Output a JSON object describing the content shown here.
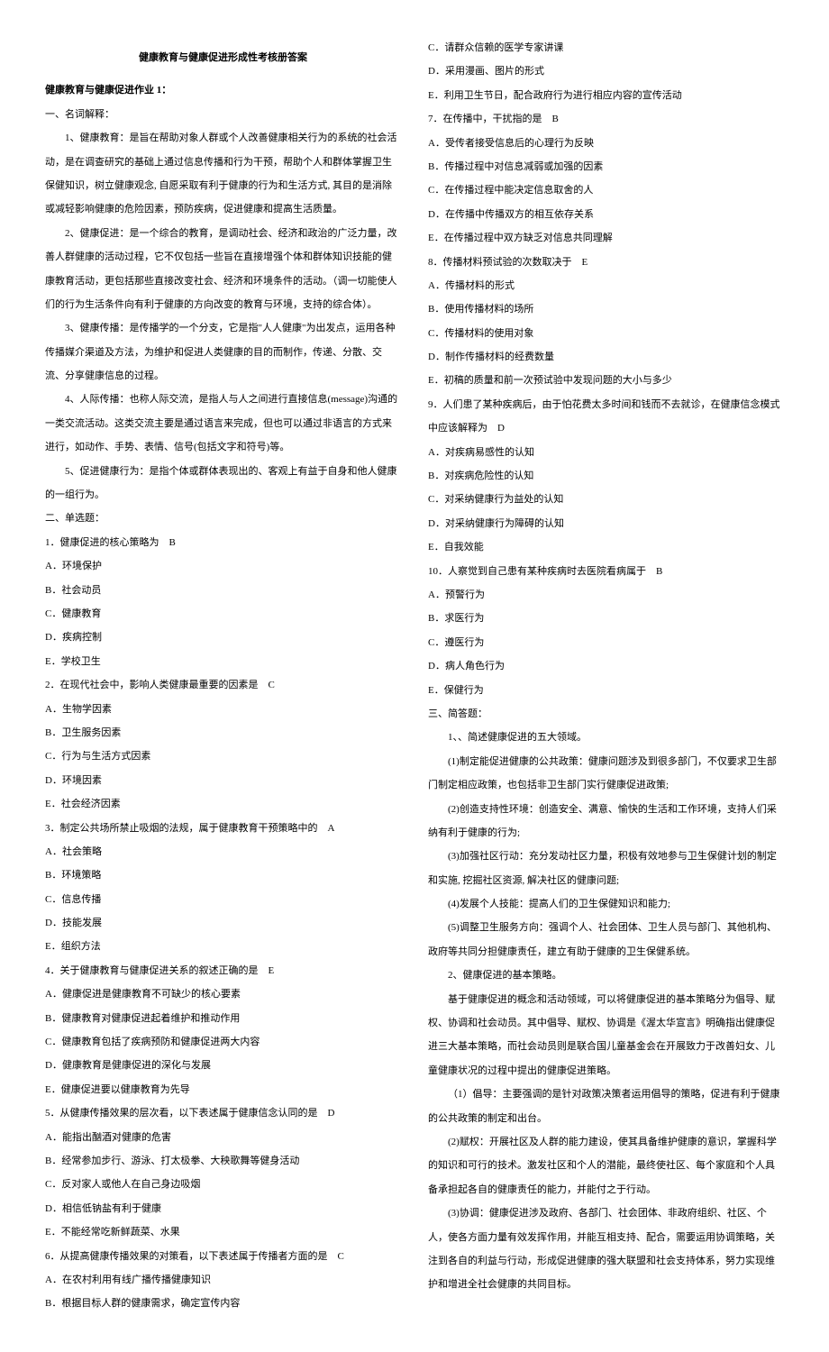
{
  "title": "健康教育与健康促进形成性考核册答案",
  "assignment": "健康教育与健康促进作业 1：",
  "sec1": "一、名词解释：",
  "def1": "1、健康教育：是旨在帮助对象人群或个人改善健康相关行为的系统的社会活动，是在调查研究的基础上通过信息传播和行为干预，帮助个人和群体掌握卫生保健知识，树立健康观念, 自愿采取有利于健康的行为和生活方式, 其目的是消除或减轻影响健康的危险因素，预防疾病，促进健康和提高生活质量。",
  "def2": "2、健康促进：是一个综合的教育，是调动社会、经济和政治的广泛力量，改善人群健康的活动过程，它不仅包括一些旨在直接增强个体和群体知识技能的健康教育活动，更包括那些直接改变社会、经济和环境条件的活动。（调一切能使人们的行为生活条件向有利于健康的方向改变的教育与环境，支持的综合体）。",
  "def3": "3、健康传播：是传播学的一个分支，它是指\"人人健康\"为出发点，运用各种传播媒介渠道及方法，为维护和促进人类健康的目的而制作，传递、分散、交流、分享健康信息的过程。",
  "def4": "4、人际传播：也称人际交流，是指人与人之间进行直接信息(message)沟通的一类交流活动。这类交流主要是通过语言来完成，但也可以通过非语言的方式来进行，如动作、手势、表情、信号(包括文字和符号)等。",
  "def5": "5、促进健康行为：是指个体或群体表现出的、客观上有益于自身和他人健康的一组行为。",
  "sec2": "二、单选题：",
  "q1": {
    "stem": "1．健康促进的核心策略为",
    "ans": "B",
    "a": "A．环境保护",
    "b": "B．社会动员",
    "c": "C．健康教育",
    "d": "D．疾病控制",
    "e": "E．学校卫生"
  },
  "q2": {
    "stem": "2．在现代社会中，影响人类健康最重要的因素是",
    "ans": "C",
    "a": "A．生物学因素",
    "b": "B．卫生服务因素",
    "c": "C．行为与生活方式因素",
    "d": "D．环境因素",
    "e": "E．社会经济因素"
  },
  "q3": {
    "stem": "3．制定公共场所禁止吸烟的法规，属于健康教育干预策略中的",
    "ans": "A",
    "a": "A．社会策略",
    "b": "B．环境策略",
    "c": "C．信息传播",
    "d": "D．技能发展",
    "e": "E．组织方法"
  },
  "q4": {
    "stem": "4．关于健康教育与健康促进关系的叙述正确的是",
    "ans": "E",
    "a": "A．健康促进是健康教育不可缺少的核心要素",
    "b": "B．健康教育对健康促进起着维护和推动作用",
    "c": "C．健康教育包括了疾病预防和健康促进两大内容",
    "d": "D．健康教育是健康促进的深化与发展",
    "e": "E．健康促进要以健康教育为先导"
  },
  "q5": {
    "stem": "5．从健康传播效果的层次看，以下表述属于健康信念认同的是",
    "ans": "D",
    "a": "A．能指出酗酒对健康的危害",
    "b": "B．经常参加步行、游泳、打太极拳、大秧歌舞等健身活动",
    "c": "C．反对家人或他人在自己身边吸烟",
    "d": "D．相信低钠盐有利于健康",
    "e": "E．不能经常吃新鲜蔬菜、水果"
  },
  "q6": {
    "stem": "6．从提高健康传播效果的对策看，以下表述属于传播者方面的是",
    "ans": "C",
    "a": "A．在农村利用有线广播传播健康知识",
    "b": "B．根据目标人群的健康需求，确定宣传内容",
    "c": "C．请群众信赖的医学专家讲课",
    "d": "D．采用漫画、图片的形式",
    "e": "E．利用卫生节日，配合政府行为进行相应内容的宣传活动"
  },
  "q7": {
    "stem": "7．在传播中，干扰指的是",
    "ans": "B",
    "a": "A．受传者接受信息后的心理行为反映",
    "b": "B．传播过程中对信息减弱或加强的因素",
    "c": "C．在传播过程中能决定信息取舍的人",
    "d": "D．在传播中传播双方的相互依存关系",
    "e": "E．在传播过程中双方缺乏对信息共同理解"
  },
  "q8": {
    "stem": "8．传播材料预试验的次数取决于",
    "ans": "E",
    "a": "A．传播材料的形式",
    "b": "B．使用传播材料的场所",
    "c": "C．传播材料的使用对象",
    "d": "D．制作传播材料的经费数量",
    "e": "E．初稿的质量和前一次预试验中发现问题的大小与多少"
  },
  "q9": {
    "stem": "9．人们患了某种疾病后，由于怕花费太多时间和钱而不去就诊，在健康信念模式中应该解释为",
    "ans": "D",
    "a": "A．对疾病易感性的认知",
    "b": "B．对疾病危险性的认知",
    "c": "C．对采纳健康行为益处的认知",
    "d": "D．对采纳健康行为障碍的认知",
    "e": "E．自我效能"
  },
  "q10": {
    "stem": "10．人察觉到自己患有某种疾病时去医院看病属于",
    "ans": "B",
    "a": "A．预警行为",
    "b": "B．求医行为",
    "c": "C．遵医行为",
    "d": "D．病人角色行为",
    "e": "E．保健行为"
  },
  "sec3": "三、简答题：",
  "sa1": "1、、简述健康促进的五大领域。",
  "sa1_1": "(1)制定能促进健康的公共政策：健康问题涉及到很多部门，不仅要求卫生部门制定相应政策，也包括非卫生部门实行健康促进政策;",
  "sa1_2": "(2)创造支持性环境：创造安全、满意、愉快的生活和工作环境，支持人们采纳有利于健康的行为;",
  "sa1_3": "(3)加强社区行动：充分发动社区力量，积极有效地参与卫生保健计划的制定和实施, 挖掘社区资源, 解决社区的健康问题;",
  "sa1_4": "(4)发展个人技能：提高人们的卫生保健知识和能力;",
  "sa1_5": "(5)调整卫生服务方向：强调个人、社会团体、卫生人员与部门、其他机构、政府等共同分担健康责任，建立有助于健康的卫生保健系统。",
  "sa2": "2、健康促进的基本策略。",
  "sa2_1": "基于健康促进的概念和活动领域，可以将健康促进的基本策略分为倡导、赋权、协调和社会动员。其中倡导、赋权、协调是《渥太华宣言》明确指出健康促进三大基本策略，而社会动员则是联合国儿童基金会在开展致力于改善妇女、儿童健康状况的过程中提出的健康促进策略。",
  "sa2_2": "（1）倡导：主要强调的是针对政策决策者运用倡导的策略，促进有利于健康的公共政策的制定和出台。",
  "sa2_3": "(2)赋权：开展社区及人群的能力建设，使其具备维护健康的意识，掌握科学的知识和可行的技术。激发社区和个人的潜能，最终使社区、每个家庭和个人具备承担起各自的健康责任的能力，并能付之于行动。",
  "sa2_4": "(3)协调：健康促进涉及政府、各部门、社会团体、非政府组织、社区、个人，使各方面力量有效发挥作用，并能互相支持、配合，需要运用协调策略，关注到各自的利益与行动，形成促进健康的强大联盟和社会支持体系，努力实现维护和增进全社会健康的共同目标。"
}
